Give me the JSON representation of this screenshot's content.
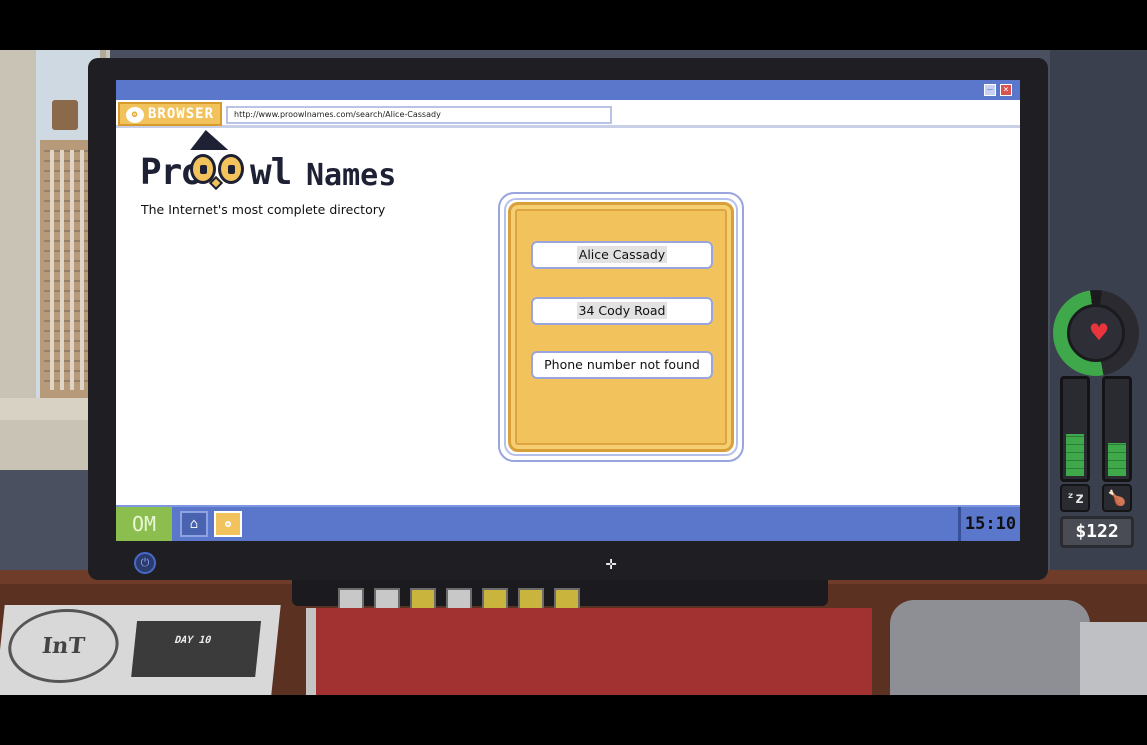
{
  "browser": {
    "tag_label": "BROWSER",
    "url": "http://www.proowlnames.com/search/Alice-Cassady"
  },
  "site": {
    "logo_pro": "Pro",
    "logo_wl": "wl",
    "logo_names": "Names",
    "tagline": "The Internet's most complete directory"
  },
  "result": {
    "name": "Alice Cassady",
    "address": "34 Cody Road",
    "phone": "Phone number not found"
  },
  "taskbar": {
    "start_label": "OM",
    "clock": "15:10"
  },
  "hud": {
    "money": "$122",
    "health_fraction": 0.5,
    "sleep_fraction": 0.45,
    "food_fraction": 0.35,
    "icons": [
      "heart-icon",
      "sleep-icon",
      "food-icon"
    ]
  },
  "newspaper": {
    "day_label": "DAY 10",
    "seal": "InT"
  },
  "colors": {
    "accent_blue": "#5a77cc",
    "accent_yellow": "#f2c35d",
    "health_green": "#3fa84a",
    "start_green": "#8bbd4f"
  }
}
